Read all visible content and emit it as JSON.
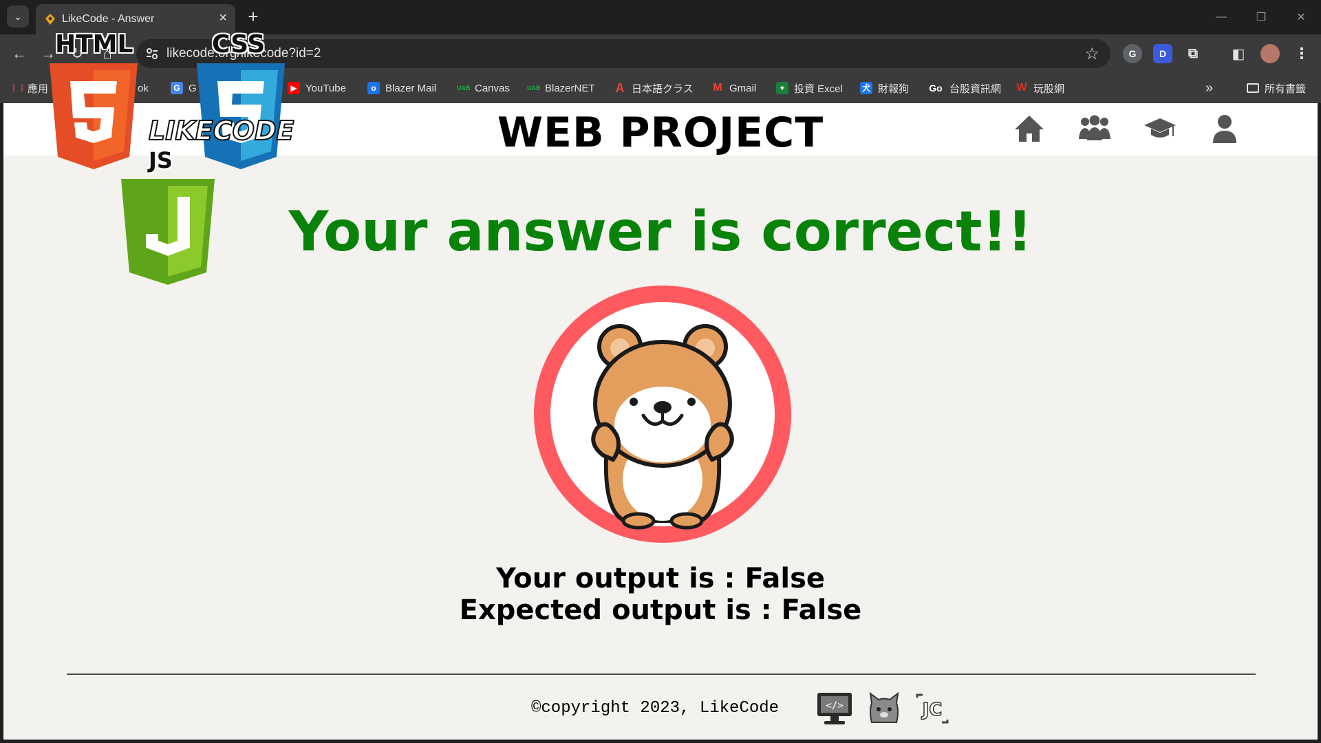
{
  "browser": {
    "tab_title": "LikeCode - Answer",
    "url": "likecode.org/likecode?id=2",
    "bookmarks": [
      {
        "label": "應用",
        "color": "#e8453c"
      },
      {
        "label": "ok",
        "color": "#4a86e8"
      },
      {
        "label": "G",
        "color": "#4a86e8"
      },
      {
        "label": "YouTube",
        "color": "#ff0000"
      },
      {
        "label": "Blazer Mail",
        "color": "#1a73e8"
      },
      {
        "label": "Canvas",
        "color": "#2aa84a"
      },
      {
        "label": "BlazerNET",
        "color": "#2aa84a"
      },
      {
        "label": "日本語クラス",
        "color": "#e8453c"
      },
      {
        "label": "Gmail",
        "color": "#ea4335"
      },
      {
        "label": "投資 Excel",
        "color": "#188038"
      },
      {
        "label": "財報狗",
        "color": "#1a73e8"
      },
      {
        "label": "台股資訊網",
        "color": "#111111"
      },
      {
        "label": "玩股網",
        "color": "#d93025"
      }
    ],
    "all_bookmarks": "所有書籤"
  },
  "overlay": {
    "html_label": "HTML",
    "css_label": "CSS",
    "js_label": "JS",
    "wordmark": "LIKECODE"
  },
  "site": {
    "title": "WEB PROJECT",
    "nav_icons": [
      "home-icon",
      "team-icon",
      "graduation-cap-icon",
      "user-icon"
    ]
  },
  "result": {
    "message": "Your answer is correct!!",
    "output_line": "Your output is : False",
    "expected_line": "Expected output is : False"
  },
  "footer": {
    "copyright": "©copyright 2023, LikeCode",
    "icons": [
      "code-monitor-icon",
      "cat-icon",
      "jc-logo-icon"
    ]
  },
  "colors": {
    "success": "#088208",
    "ring": "#ff5a5f",
    "bear": "#e39d5c",
    "page_bg": "#f3f2ef"
  }
}
